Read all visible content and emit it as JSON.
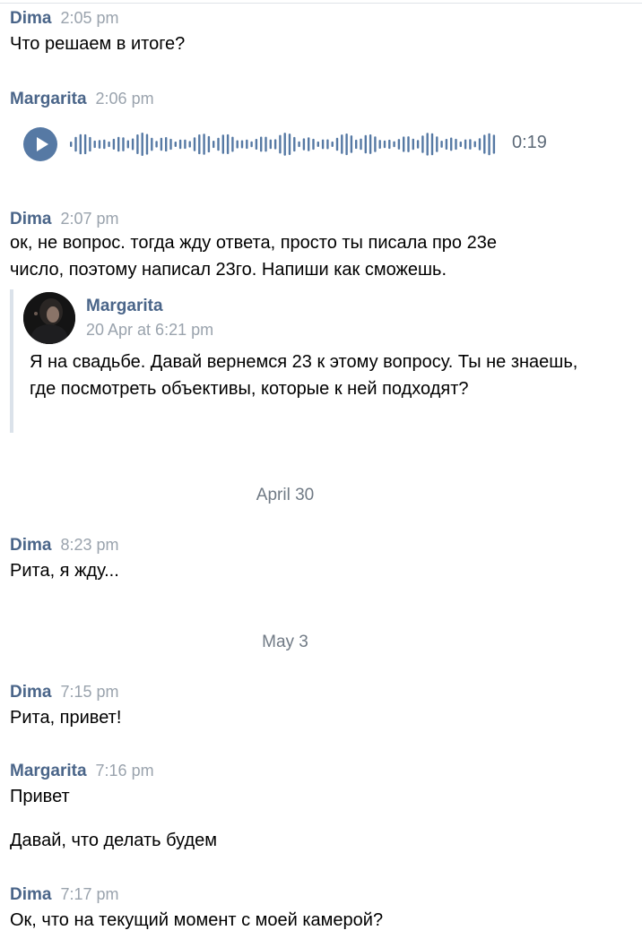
{
  "messages": [
    {
      "author": "Dima",
      "time": "2:05 pm",
      "text": "Что решаем в итоге?"
    },
    {
      "author": "Margarita",
      "time": "2:06 pm",
      "voice_duration": "0:19"
    },
    {
      "author": "Dima",
      "time": "2:07 pm",
      "text": "ок, не вопрос. тогда жду ответа, просто ты писала про 23е\nчисло, поэтому написал 23го. Напиши как сможешь."
    },
    {
      "author": "Dima",
      "time": "8:23 pm",
      "text": "Рита, я жду..."
    },
    {
      "author": "Dima",
      "time": "7:15 pm",
      "text": "Рита, привет!"
    },
    {
      "author": "Margarita",
      "time": "7:16 pm",
      "text": "Привет",
      "text2": "Давай, что делать будем"
    },
    {
      "author": "Dima",
      "time": "7:17 pm",
      "text": "Ок, что на текущий момент с моей камерой?"
    }
  ],
  "quote": {
    "author": "Margarita",
    "date": "20 Apr at 6:21 pm",
    "text": "Я на свадьбе. Давай вернемся 23 к этому вопросу. Ты не знаешь, где посмотреть объективы, которые к ней подходят?"
  },
  "date_separators": [
    "April 30",
    "May 3"
  ],
  "icons": {
    "play": "play-icon"
  },
  "colors": {
    "author": "#4a6589",
    "time": "#9aa3ad",
    "accent": "#5679a4"
  }
}
